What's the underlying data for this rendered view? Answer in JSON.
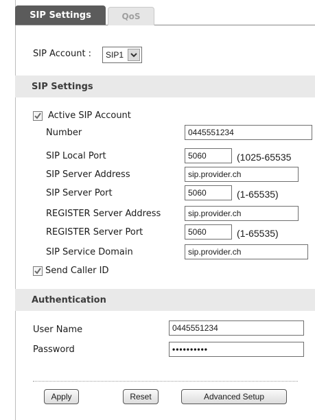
{
  "tabs": {
    "active": "SIP Settings",
    "inactive": "QoS"
  },
  "account": {
    "label": "SIP Account :",
    "selected": "SIP1"
  },
  "sip_settings": {
    "heading": "SIP Settings",
    "active_account_label": "Active SIP Account",
    "active_account_checked": true,
    "number_label": "Number",
    "number_value": "0445551234",
    "local_port_label": "SIP Local Port",
    "local_port_value": "5060",
    "local_port_range": "(1025-65535",
    "server_address_label": "SIP Server Address",
    "server_address_value": "sip.provider.ch",
    "server_port_label": "SIP Server Port",
    "server_port_value": "5060",
    "server_port_range": "(1-65535)",
    "register_address_label": "REGISTER Server Address",
    "register_address_value": "sip.provider.ch",
    "register_port_label": "REGISTER Server Port",
    "register_port_value": "5060",
    "register_port_range": "(1-65535)",
    "service_domain_label": "SIP Service Domain",
    "service_domain_value": "sip.provider.ch",
    "caller_id_label": "Send Caller ID",
    "caller_id_checked": true
  },
  "authentication": {
    "heading": "Authentication",
    "username_label": "User Name",
    "username_value": "0445551234",
    "password_label": "Password",
    "password_value": "••••••••••"
  },
  "buttons": {
    "apply": "Apply",
    "reset": "Reset",
    "advanced": "Advanced Setup"
  },
  "icons": {
    "check": "check-icon",
    "dropdown": "chevron-down-icon"
  }
}
